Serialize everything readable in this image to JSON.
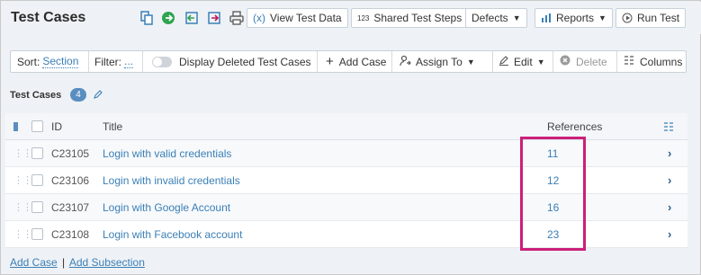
{
  "header": {
    "title": "Test Cases",
    "icons": [
      "copy-icon",
      "export-icon",
      "import-icon",
      "move-icon",
      "print-icon"
    ],
    "buttons": {
      "view_test_data": "View Test Data",
      "shared_test_steps": "Shared Test Steps",
      "shared_steps_prefix": "123",
      "defects": "Defects",
      "reports": "Reports",
      "run_test": "Run Test"
    }
  },
  "toolbar": {
    "sort_label": "Sort:",
    "sort_value": "Section",
    "filter_label": "Filter:",
    "filter_value": "...",
    "display_deleted": "Display Deleted Test Cases",
    "add_case": "Add Case",
    "assign_to": "Assign To",
    "edit": "Edit",
    "delete": "Delete",
    "columns": "Columns"
  },
  "section": {
    "title": "Test Cases",
    "count": "4"
  },
  "table": {
    "headers": {
      "id": "ID",
      "title": "Title",
      "references": "References"
    },
    "rows": [
      {
        "id": "C23105",
        "title": "Login with valid credentials",
        "references": "11"
      },
      {
        "id": "C23106",
        "title": "Login with invalid credentials",
        "references": "12"
      },
      {
        "id": "C23107",
        "title": "Login with Google Account",
        "references": "16"
      },
      {
        "id": "C23108",
        "title": "Login with Facebook account",
        "references": "23"
      }
    ]
  },
  "footer": {
    "add_case": "Add Case",
    "separator": "|",
    "add_subsection": "Add Subsection"
  },
  "colors": {
    "accent": "#3b7fb6",
    "highlight": "#cc1f7a",
    "badge": "#5a8ec0",
    "export_green": "#2ea44f",
    "move_magenta": "#c2185b"
  }
}
